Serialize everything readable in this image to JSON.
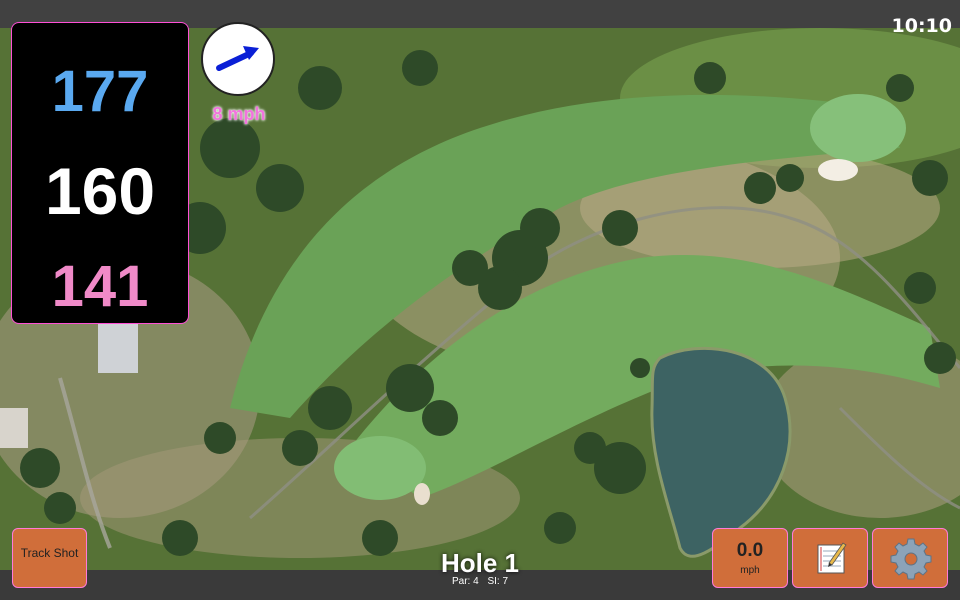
{
  "status": {
    "time": "10:10"
  },
  "distances": {
    "back": "177",
    "middle": "160",
    "front": "141"
  },
  "wind": {
    "speed_label": "8 mph",
    "gauge_value": "0.0",
    "gauge_unit": "mph"
  },
  "buttons": {
    "track_shot_label": "Track Shot"
  },
  "hole": {
    "title": "Hole 1",
    "par_label": "Par: 4",
    "si_label": "SI: 7"
  },
  "icons": {
    "wind_direction": "arrow-icon",
    "notes": "notepad-icon",
    "settings": "gear-icon"
  },
  "colors": {
    "back_distance": "#5aa9f0",
    "middle_distance": "#ffffff",
    "front_distance": "#f08ac8",
    "button": "#d06e3a",
    "accent": "#ff4fd6"
  }
}
